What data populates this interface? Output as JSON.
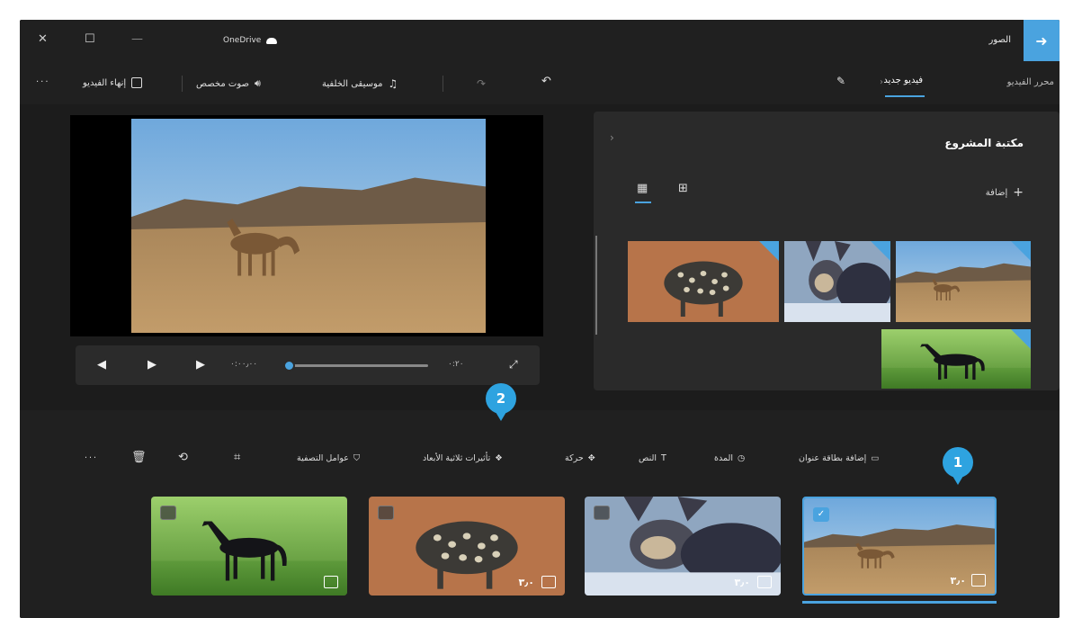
{
  "window": {
    "title": "الصور",
    "onedrive_label": "OneDrive",
    "close_glyph": "✕",
    "max_glyph": "☐",
    "min_glyph": "—"
  },
  "commandbar": {
    "breadcrumb_root": "محرر الفيديو",
    "breadcrumb_current": "فيديو جديد",
    "bg_music": "موسيقى الخلفية",
    "custom_audio": "صوت مخصص",
    "finish_video": "إنهاء الفيديو",
    "more": "···"
  },
  "player": {
    "time_current": "٠:٠٠٫٠٠",
    "time_total": "٠:٢٠",
    "progress": 0.02
  },
  "library": {
    "title": "مكتبة المشروع",
    "import_label": "إضافة",
    "items": [
      "jaguar",
      "cat",
      "camel",
      "horse"
    ]
  },
  "storyboard": {
    "tools": {
      "add_title_card": "إضافة بطاقة عنوان",
      "duration": "المدة",
      "text": "النص",
      "motion": "حركة",
      "effects_3d": "تأثيرات ثلاثية الأبعاد",
      "filters": "عوامل التصفية",
      "more": "···"
    },
    "clips": [
      {
        "name": "camel",
        "duration": "٣٫٠"
      },
      {
        "name": "cat",
        "duration": "٣٫٠"
      },
      {
        "name": "jaguar",
        "duration": "٣٫٠"
      },
      {
        "name": "horse",
        "duration": ""
      }
    ]
  },
  "callouts": {
    "one": "1",
    "two": "2"
  },
  "colors": {
    "accent": "#4aa3df",
    "badge": "#2ea3e0",
    "app_bg": "#1c1c1c"
  }
}
